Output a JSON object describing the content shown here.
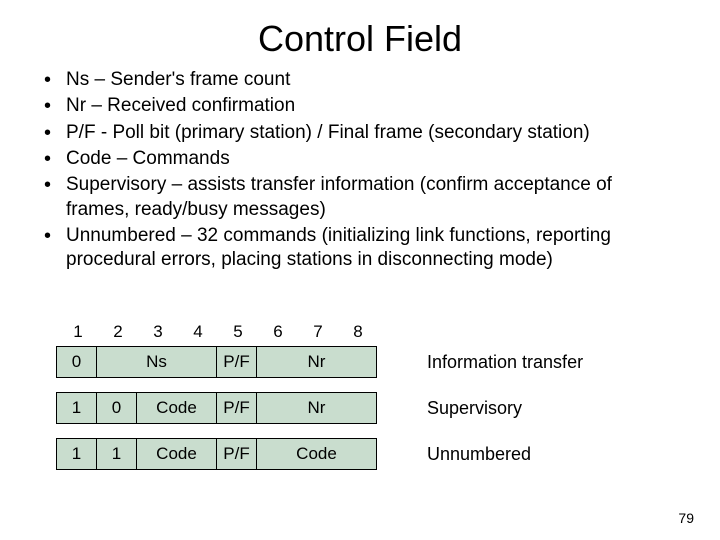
{
  "title": "Control Field",
  "bullets": [
    "Ns – Sender's frame count",
    "Nr – Received confirmation",
    "P/F - Poll bit (primary station) / Final frame (secondary station)",
    "Code – Commands",
    "Supervisory – assists transfer information (confirm acceptance of frames, ready/busy messages)",
    "Unnumbered – 32 commands (initializing link functions, reporting procedural errors, placing stations in disconnecting mode)"
  ],
  "bits": [
    "1",
    "2",
    "3",
    "4",
    "5",
    "6",
    "7",
    "8"
  ],
  "rows": {
    "info": {
      "c0": "0",
      "ns": "Ns",
      "pf": "P/F",
      "nr": "Nr",
      "label": "Information transfer"
    },
    "sup": {
      "c0": "1",
      "c1": "0",
      "code": "Code",
      "pf": "P/F",
      "nr": "Nr",
      "label": "Supervisory"
    },
    "unn": {
      "c0": "1",
      "c1": "1",
      "code": "Code",
      "pf": "P/F",
      "code2": "Code",
      "label": "Unnumbered"
    }
  },
  "page": "79",
  "chart_data": {
    "type": "table",
    "title": "HDLC Control Field bit layout",
    "bit_positions": [
      1,
      2,
      3,
      4,
      5,
      6,
      7,
      8
    ],
    "formats": [
      {
        "name": "Information transfer",
        "fields": [
          {
            "bits": "1",
            "value": "0"
          },
          {
            "bits": "2-4",
            "value": "Ns"
          },
          {
            "bits": "5",
            "value": "P/F"
          },
          {
            "bits": "6-8",
            "value": "Nr"
          }
        ]
      },
      {
        "name": "Supervisory",
        "fields": [
          {
            "bits": "1",
            "value": "1"
          },
          {
            "bits": "2",
            "value": "0"
          },
          {
            "bits": "3-4",
            "value": "Code"
          },
          {
            "bits": "5",
            "value": "P/F"
          },
          {
            "bits": "6-8",
            "value": "Nr"
          }
        ]
      },
      {
        "name": "Unnumbered",
        "fields": [
          {
            "bits": "1",
            "value": "1"
          },
          {
            "bits": "2",
            "value": "1"
          },
          {
            "bits": "3-4",
            "value": "Code"
          },
          {
            "bits": "5",
            "value": "P/F"
          },
          {
            "bits": "6-8",
            "value": "Code"
          }
        ]
      }
    ]
  }
}
